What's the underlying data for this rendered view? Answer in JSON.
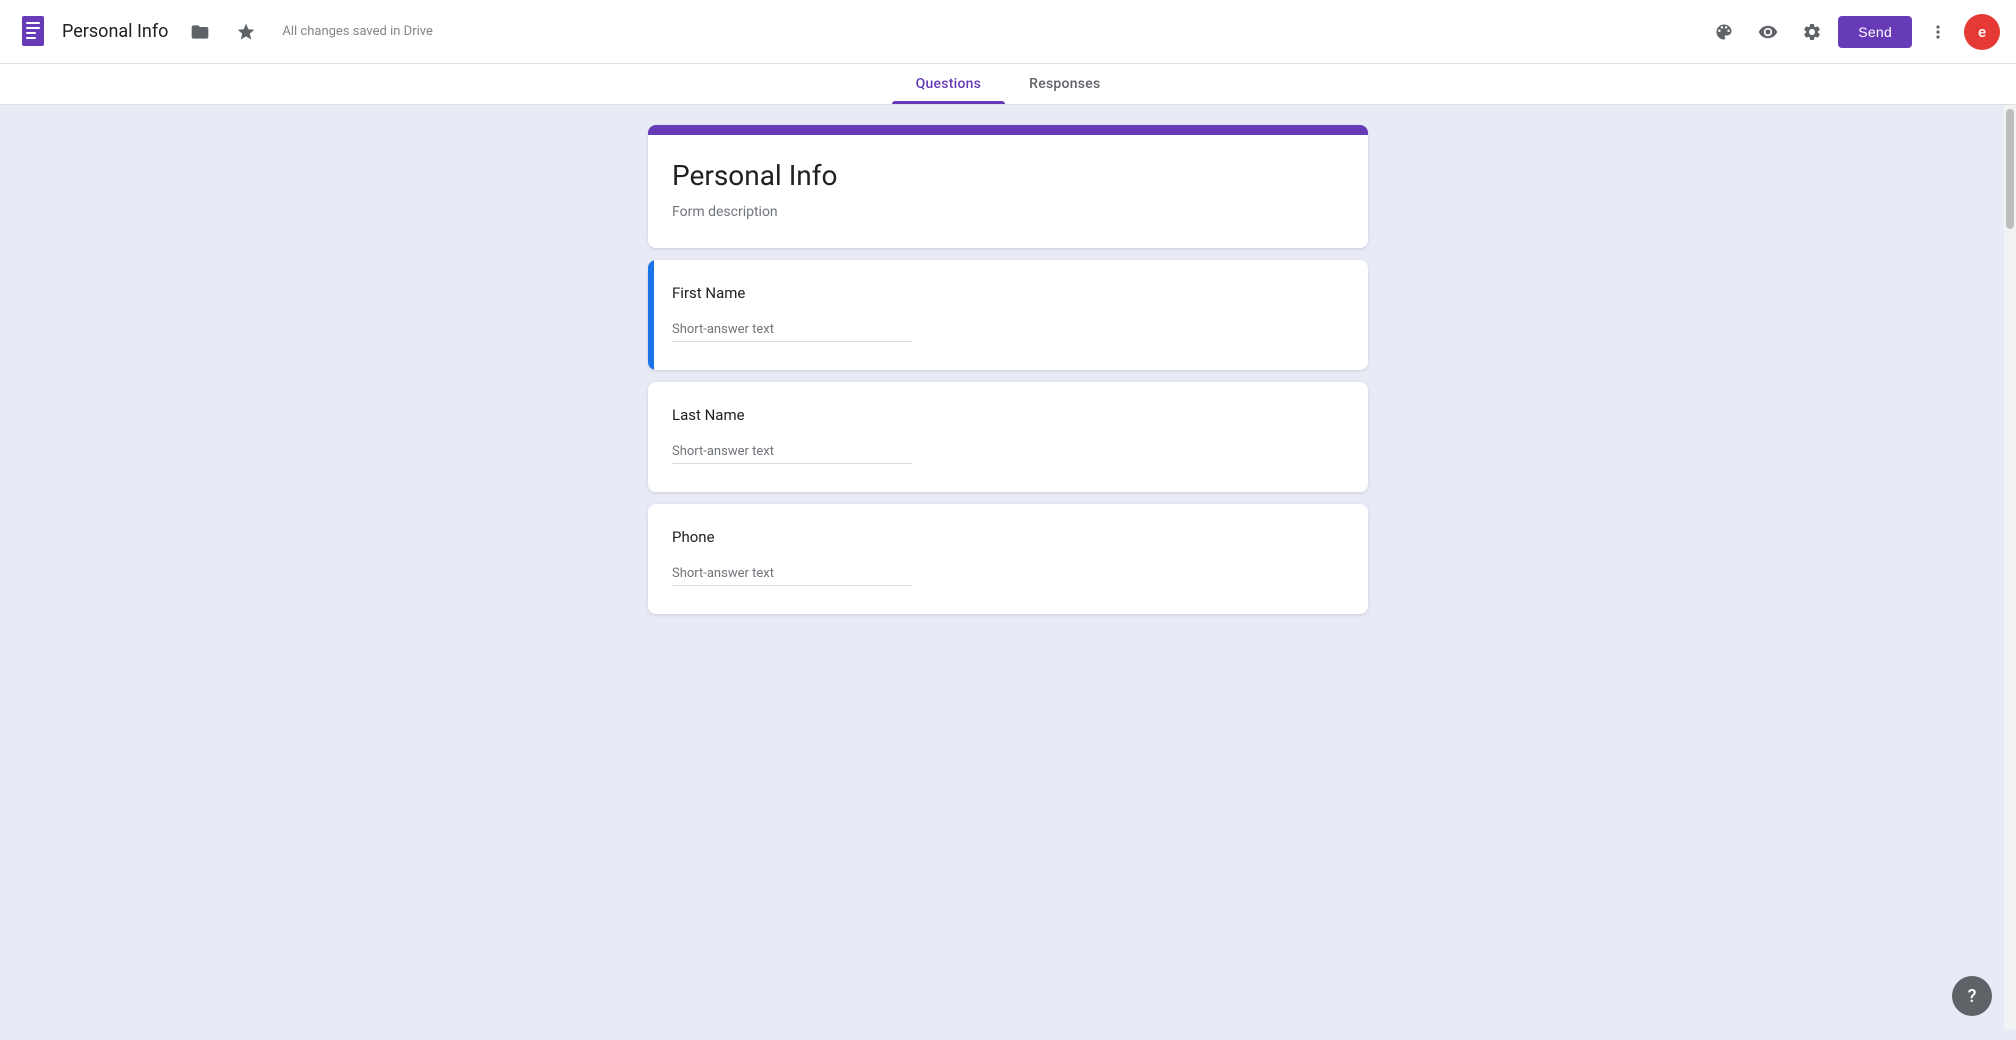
{
  "toolbar": {
    "app_icon_label": "Google Forms",
    "doc_title": "Personal Info",
    "auto_save_text": "All changes saved in Drive",
    "folder_icon": "folder",
    "star_icon": "star",
    "palette_icon": "palette",
    "preview_icon": "preview",
    "settings_icon": "settings",
    "more_icon": "more-vert",
    "send_button_label": "Send",
    "avatar_letter": "e"
  },
  "tabs": [
    {
      "label": "Questions",
      "active": true
    },
    {
      "label": "Responses",
      "active": false
    }
  ],
  "form": {
    "title": "Personal Info",
    "description": "Form description",
    "questions": [
      {
        "id": 1,
        "label": "First Name",
        "type": "short-answer",
        "placeholder": "Short-answer text",
        "active": true
      },
      {
        "id": 2,
        "label": "Last Name",
        "type": "short-answer",
        "placeholder": "Short-answer text",
        "active": false
      },
      {
        "id": 3,
        "label": "Phone",
        "type": "short-answer",
        "placeholder": "Short-answer text",
        "active": false
      }
    ]
  },
  "help_button_label": "?",
  "colors": {
    "brand_purple": "#673ab7",
    "active_blue": "#1a73e8",
    "background": "#e8eaf6"
  }
}
